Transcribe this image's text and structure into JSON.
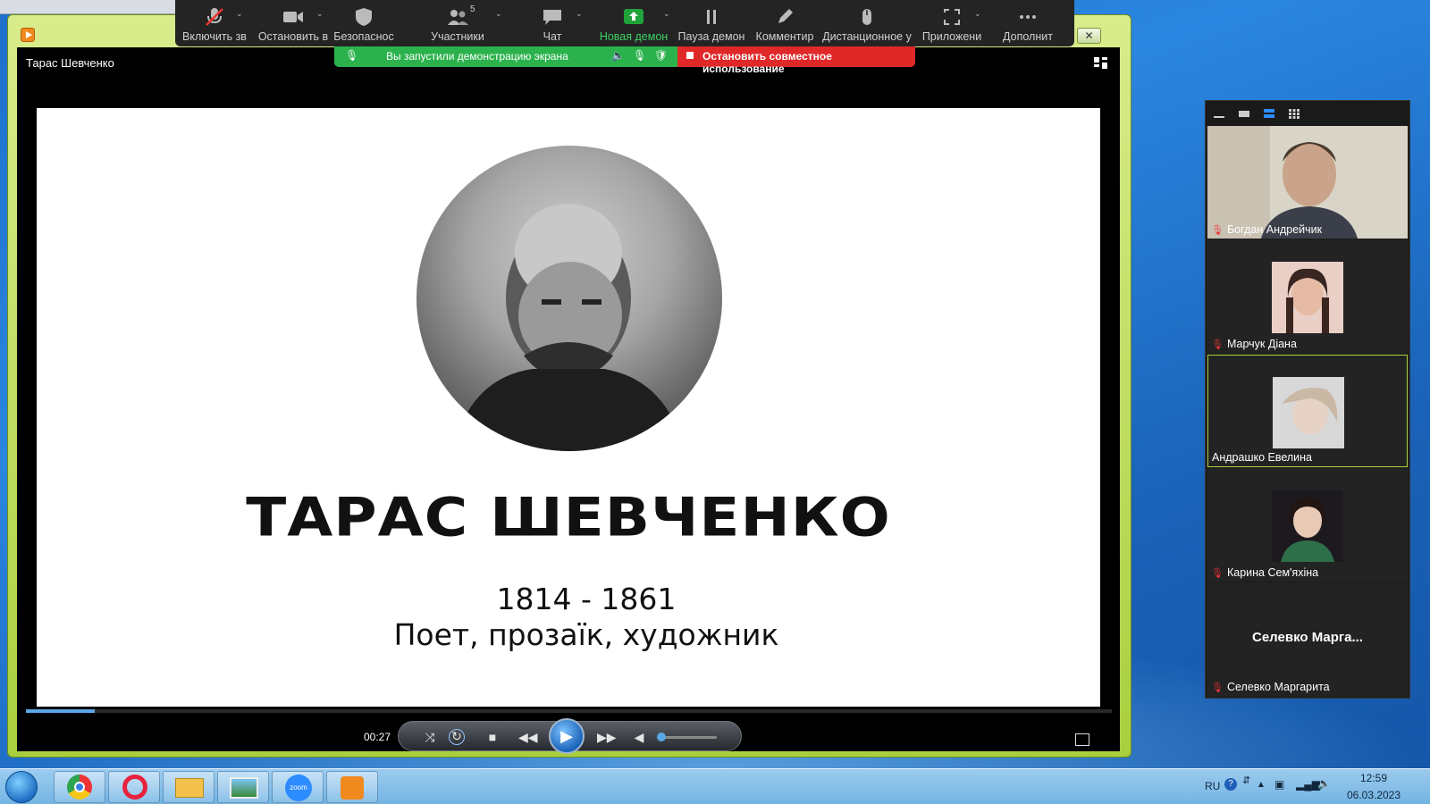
{
  "desktop": {
    "taskbar_items": [
      "chrome-icon",
      "opera-icon",
      "explorer-icon",
      "photo-viewer-icon",
      "zoom-icon",
      "media-player-icon"
    ]
  },
  "player": {
    "video_title": "Тарас Шевченко",
    "time": "00:27",
    "progress": 0.063,
    "volume": 0.0
  },
  "slide": {
    "title": "ТАРАС ШЕВЧЕНКО",
    "years": "1814 - 1861",
    "subtitle": "Поет, прозаїк, художник"
  },
  "zoom_toolbar": {
    "items": [
      {
        "label": "Включить зв",
        "icon": "muted-mic-icon"
      },
      {
        "label": "Остановить в",
        "icon": "video-camera-icon"
      },
      {
        "label": "Безопаснос",
        "icon": "shield-icon"
      },
      {
        "label": "Участники",
        "icon": "participants-icon",
        "count": "5"
      },
      {
        "label": "Чат",
        "icon": "chat-icon"
      },
      {
        "label": "Новая демон",
        "icon": "share-screen-icon"
      },
      {
        "label": "Пауза демон",
        "icon": "pause-icon"
      },
      {
        "label": "Комментир",
        "icon": "annotate-icon"
      },
      {
        "label": "Дистанционное у",
        "icon": "remote-control-icon"
      },
      {
        "label": "Приложени",
        "icon": "apps-icon"
      },
      {
        "label": "Дополнит",
        "icon": "more-icon"
      }
    ],
    "share_status": "Вы запустили демонстрацию экрана",
    "stop_share": "Остановить совместное использование",
    "colors": {
      "share_green": "#2bb24c",
      "stop_red": "#e02828",
      "accent_green": "#1fa33a"
    }
  },
  "participants": [
    {
      "name": "Богдан Андрейчик",
      "muted": true,
      "video": "full"
    },
    {
      "name": "Марчук Діана",
      "muted": true,
      "video": "thumb"
    },
    {
      "name": "Андрашко Евелина",
      "muted": false,
      "video": "thumb",
      "active": true
    },
    {
      "name": "Карина Сем'яхіна",
      "muted": true,
      "video": "thumb"
    },
    {
      "name": "Селевко Маргарита",
      "muted": true,
      "video": "none",
      "display_name": "Селевко  Марга..."
    }
  ],
  "tray": {
    "language": "RU",
    "time": "12:59",
    "date": "06.03.2023"
  }
}
